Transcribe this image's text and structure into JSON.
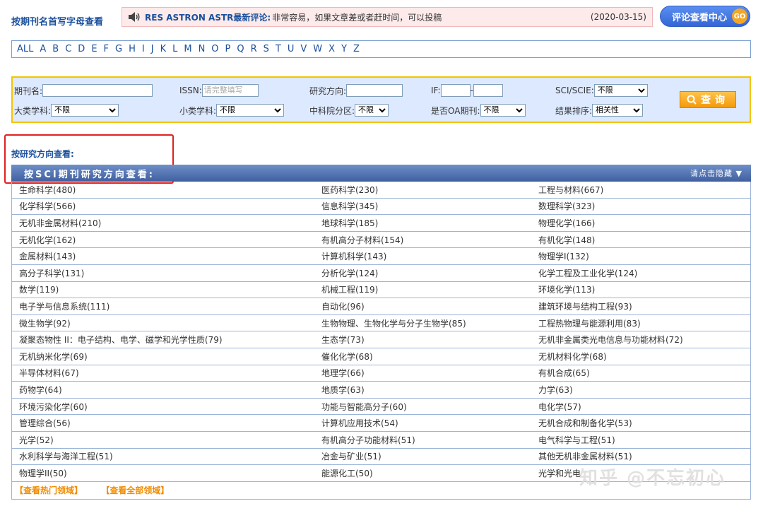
{
  "header": {
    "title": "按期刊名首写字母查看",
    "notice_author": "RES ASTRON ASTR最新评论:",
    "notice_text": "非常容易，如果文章差或者赶时间，可以投稿",
    "notice_date": "(2020-03-15)",
    "review_button": "评论查看中心",
    "go_label": "GO"
  },
  "alphabet": [
    "ALL",
    "A",
    "B",
    "C",
    "D",
    "E",
    "F",
    "G",
    "H",
    "I",
    "J",
    "K",
    "L",
    "M",
    "N",
    "O",
    "P",
    "Q",
    "R",
    "S",
    "T",
    "U",
    "V",
    "W",
    "X",
    "Y",
    "Z"
  ],
  "search": {
    "journal_label": "期刊名:",
    "journal_value": "",
    "issn_label": "ISSN:",
    "issn_placeholder": "请完整填写",
    "direction_label": "研究方向:",
    "if_label": "IF:",
    "if_sep": "-",
    "sci_label": "SCI/SCIE:",
    "sci_value": "不限",
    "major_label": "大类学科:",
    "major_value": "不限",
    "minor_label": "小类学科:",
    "minor_value": "不限",
    "cas_label": "中科院分区:",
    "cas_value": "不限",
    "oa_label": "是否OA期刊:",
    "oa_value": "不限",
    "sort_label": "结果排序:",
    "sort_value": "相关性",
    "button_label": "查询"
  },
  "section": {
    "title": "按研究方向查看:",
    "bar_left": "按SCI期刊研究方向查看:",
    "bar_right": "请点击隐藏 ▼"
  },
  "rows": [
    [
      "生命科学(480)",
      "医药科学(230)",
      "工程与材料(667)"
    ],
    [
      "化学科学(566)",
      "信息科学(345)",
      "数理科学(323)"
    ],
    [
      "无机非金属材料(210)",
      "地球科学(185)",
      "物理化学(166)"
    ],
    [
      "无机化学(162)",
      "有机高分子材料(154)",
      "有机化学(148)"
    ],
    [
      "金属材料(143)",
      "计算机科学(143)",
      "物理学I(132)"
    ],
    [
      "高分子科学(131)",
      "分析化学(124)",
      "化学工程及工业化学(124)"
    ],
    [
      "数学(119)",
      "机械工程(119)",
      "环境化学(113)"
    ],
    [
      "电子学与信息系统(111)",
      "自动化(96)",
      "建筑环境与结构工程(93)"
    ],
    [
      "微生物学(92)",
      "生物物理、生物化学与分子生物学(85)",
      "工程热物理与能源利用(83)"
    ],
    [
      "凝聚态物性 II：电子结构、电学、磁学和光学性质(79)",
      "生态学(73)",
      "无机非金属类光电信息与功能材料(72)"
    ],
    [
      "无机纳米化学(69)",
      "催化化学(68)",
      "无机材料化学(68)"
    ],
    [
      "半导体材料(67)",
      "地理学(66)",
      "有机合成(65)"
    ],
    [
      "药物学(64)",
      "地质学(63)",
      "力学(63)"
    ],
    [
      "环境污染化学(60)",
      "功能与智能高分子(60)",
      "电化学(57)"
    ],
    [
      "管理综合(56)",
      "计算机应用技术(54)",
      "无机合成和制备化学(53)"
    ],
    [
      "光学(52)",
      "有机高分子功能材料(51)",
      "电气科学与工程(51)"
    ],
    [
      "水利科学与海洋工程(51)",
      "冶金与矿业(51)",
      "其他无机非金属材料(51)"
    ],
    [
      "物理学II(50)",
      "能源化工(50)",
      "光学和光电"
    ]
  ],
  "footer": {
    "hot": "【查看热门领域】",
    "all": "【查看全部领域】"
  },
  "watermark": "知乎 @不忘初心"
}
